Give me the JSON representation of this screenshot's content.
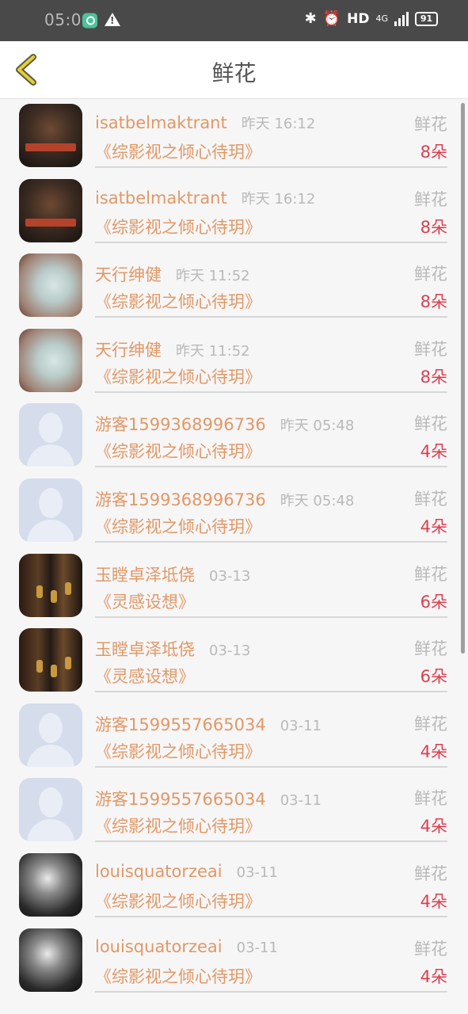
{
  "status_bar": {
    "time": "05:06",
    "hd_label": "HD",
    "network_label": "4G",
    "battery": "91"
  },
  "nav": {
    "title": "鲜花"
  },
  "items": [
    {
      "user": "isatbelmaktrant",
      "time": "昨天 16:12",
      "tag": "鲜花",
      "book": "《综影视之倾心待玥》",
      "count": "8朵",
      "avatar": "a1"
    },
    {
      "user": "isatbelmaktrant",
      "time": "昨天 16:12",
      "tag": "鲜花",
      "book": "《综影视之倾心待玥》",
      "count": "8朵",
      "avatar": "a1"
    },
    {
      "user": "天行绅健",
      "time": "昨天 11:52",
      "tag": "鲜花",
      "book": "《综影视之倾心待玥》",
      "count": "8朵",
      "avatar": "a2"
    },
    {
      "user": "天行绅健",
      "time": "昨天 11:52",
      "tag": "鲜花",
      "book": "《综影视之倾心待玥》",
      "count": "8朵",
      "avatar": "a2"
    },
    {
      "user": "游客1599368996736",
      "time": "昨天 05:48",
      "tag": "鲜花",
      "book": "《综影视之倾心待玥》",
      "count": "4朵",
      "avatar": "a3"
    },
    {
      "user": "游客1599368996736",
      "time": "昨天 05:48",
      "tag": "鲜花",
      "book": "《综影视之倾心待玥》",
      "count": "4朵",
      "avatar": "a3"
    },
    {
      "user": "玉瞠卓泽坻侥",
      "time": "03-13",
      "tag": "鲜花",
      "book": "《灵感设想》",
      "count": "6朵",
      "avatar": "a4"
    },
    {
      "user": "玉瞠卓泽坻侥",
      "time": "03-13",
      "tag": "鲜花",
      "book": "《灵感设想》",
      "count": "6朵",
      "avatar": "a4"
    },
    {
      "user": "游客1599557665034",
      "time": "03-11",
      "tag": "鲜花",
      "book": "《综影视之倾心待玥》",
      "count": "4朵",
      "avatar": "a3"
    },
    {
      "user": "游客1599557665034",
      "time": "03-11",
      "tag": "鲜花",
      "book": "《综影视之倾心待玥》",
      "count": "4朵",
      "avatar": "a3"
    },
    {
      "user": "louisquatorzeai",
      "time": "03-11",
      "tag": "鲜花",
      "book": "《综影视之倾心待玥》",
      "count": "4朵",
      "avatar": "a5"
    },
    {
      "user": "louisquatorzeai",
      "time": "03-11",
      "tag": "鲜花",
      "book": "《综影视之倾心待玥》",
      "count": "4朵",
      "avatar": "a5"
    }
  ]
}
